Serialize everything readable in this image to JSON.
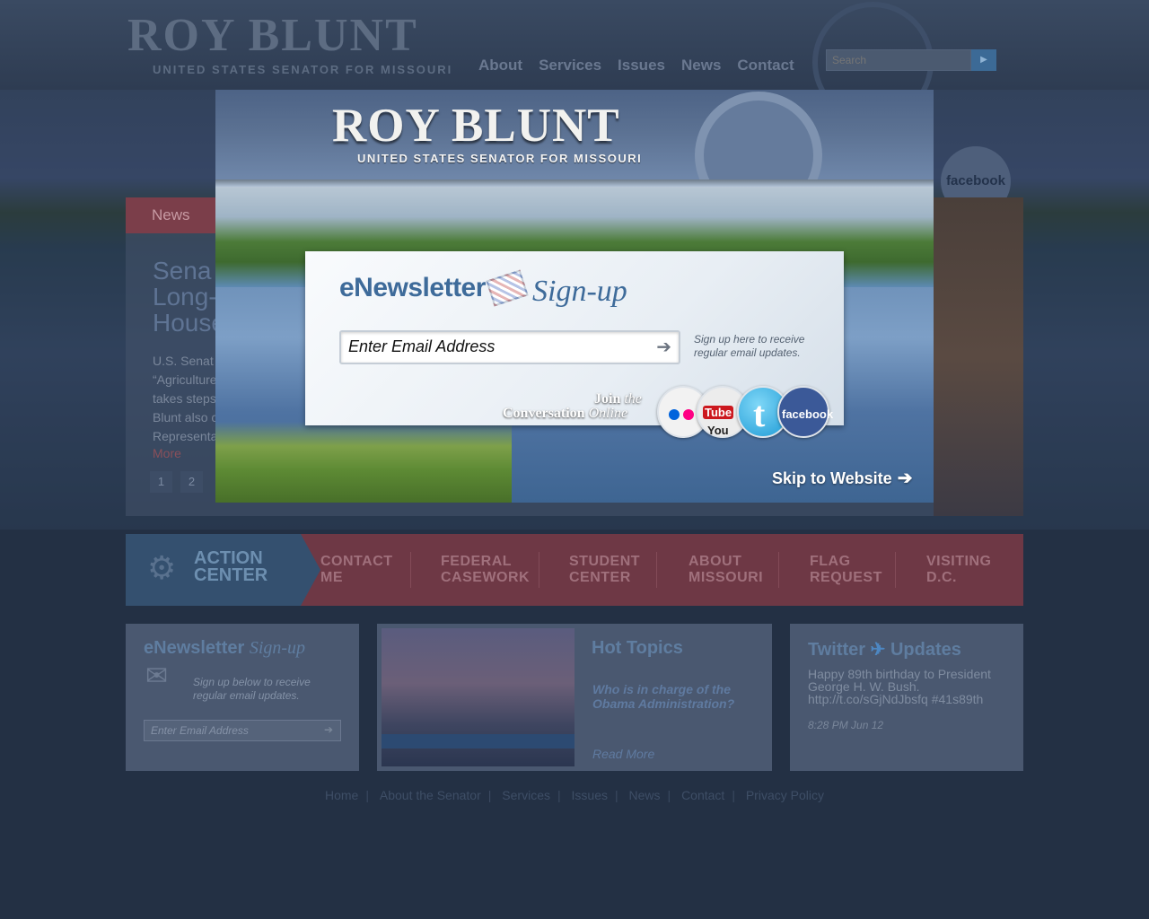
{
  "site": {
    "logo": "ROY BLUNT",
    "logo_subtitle": "UNITED STATES SENATOR FOR MISSOURI",
    "nav": [
      "About",
      "Services",
      "Issues",
      "News",
      "Contact"
    ],
    "search_placeholder": "Search",
    "facebook_label": "facebook"
  },
  "news": {
    "tab": "News",
    "headline": "Sena\nLong-\nHouse",
    "body_lines": [
      "U.S. Senat",
      "“Agriculture",
      "takes steps",
      "Blunt also c",
      "Representa"
    ],
    "more": "More",
    "pages": [
      "1",
      "2"
    ]
  },
  "action_center": {
    "label_line1": "ACTION",
    "label_line2": "CENTER",
    "items": [
      {
        "l1": "CONTACT",
        "l2": "ME"
      },
      {
        "l1": "FEDERAL",
        "l2": "CASEWORK"
      },
      {
        "l1": "STUDENT",
        "l2": "CENTER"
      },
      {
        "l1": "ABOUT",
        "l2": "MISSOURI"
      },
      {
        "l1": "FLAG",
        "l2": "REQUEST"
      },
      {
        "l1": "VISITING",
        "l2": "D.C."
      }
    ]
  },
  "newsletter_box": {
    "title": "eNewsletter",
    "title_script": "Sign-up",
    "note": "Sign up below to receive regular email updates.",
    "placeholder": "Enter Email Address"
  },
  "hot_topics": {
    "title": "Hot Topics",
    "headline": "Who is in charge of the Obama Administration?",
    "read_more": "Read More"
  },
  "twitter": {
    "title": "Twitter",
    "title2": "Updates",
    "tweet": "Happy 89th birthday to President George H. W. Bush. http://t.co/sGjNdJbsfq #41s89th",
    "time": "8:28 PM Jun 12"
  },
  "footer": [
    "Home",
    "About the Senator",
    "Services",
    "Issues",
    "News",
    "Contact",
    "Privacy Policy"
  ],
  "modal": {
    "logo": "ROY BLUNT",
    "logo_subtitle": "UNITED STATES SENATOR FOR MISSOURI",
    "signup_title": "eNewsletter",
    "signup_title_script": "Sign-up",
    "email_placeholder": "Enter Email Address",
    "note": "Sign up here to receive regular email updates.",
    "join_1a": "Join",
    "join_1b": "the",
    "join_2a": "Conversation",
    "join_2b": "Online",
    "social": {
      "youtube_a": "You",
      "youtube_b": "Tube",
      "twitter": "t",
      "facebook": "facebook"
    },
    "skip": "Skip to Website"
  }
}
